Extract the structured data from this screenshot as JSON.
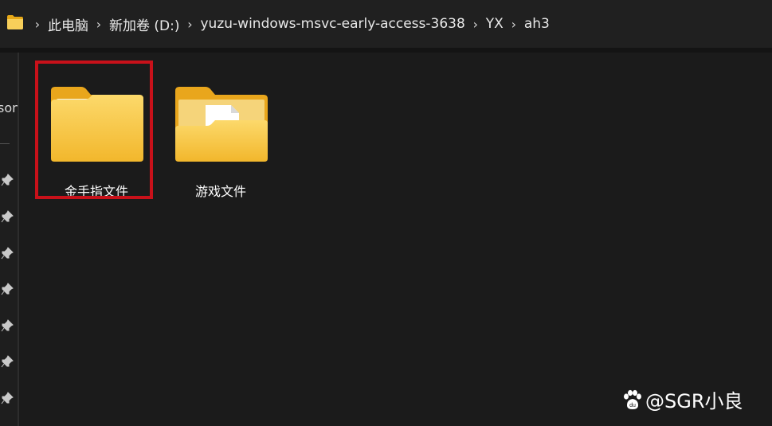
{
  "breadcrumb": {
    "items": [
      "此电脑",
      "新加卷 (D:)",
      "yuzu-windows-msvc-early-access-3638",
      "YX",
      "ah3"
    ],
    "separator": "›"
  },
  "nav_pane": {
    "clipped_label": "son",
    "pins": [
      "pin-icon",
      "pin-icon",
      "pin-icon",
      "pin-icon",
      "pin-icon",
      "pin-icon",
      "pin-icon"
    ]
  },
  "files": [
    {
      "name": "金手指文件",
      "icon": "folder-icon",
      "selected_highlight": true
    },
    {
      "name": "游戏文件",
      "icon": "folder-with-document-icon",
      "selected_highlight": false
    }
  ],
  "watermark": {
    "text": "@SGR小良",
    "icon": "baidu-paw-icon"
  },
  "colors": {
    "background": "#1b1b1b",
    "address_bar": "#202020",
    "highlight": "#c8111a",
    "folder_yellow": "#f7c948"
  }
}
